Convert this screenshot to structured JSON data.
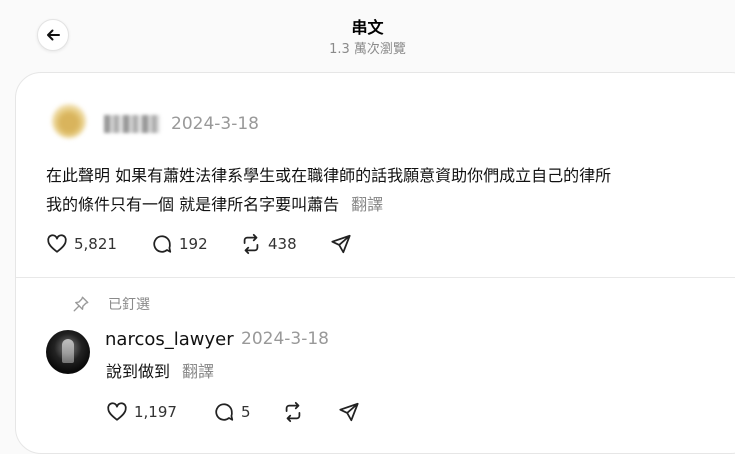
{
  "header": {
    "title": "串文",
    "views": "1.3 萬次瀏覽"
  },
  "post": {
    "date": "2024-3-18",
    "line1": "在此聲明 如果有蕭姓法律系學生或在職律師的話我願意資助你們成立自己的律所",
    "line2": "我的條件只有一個 就是律所名字要叫蕭告",
    "translate": "翻譯",
    "likes": "5,821",
    "comments": "192",
    "reposts": "438"
  },
  "pinned": {
    "label": "已釘選"
  },
  "reply": {
    "username": "narcos_lawyer",
    "date": "2024-3-18",
    "text": "說到做到",
    "translate": "翻譯",
    "likes": "1,197",
    "comments": "5"
  }
}
